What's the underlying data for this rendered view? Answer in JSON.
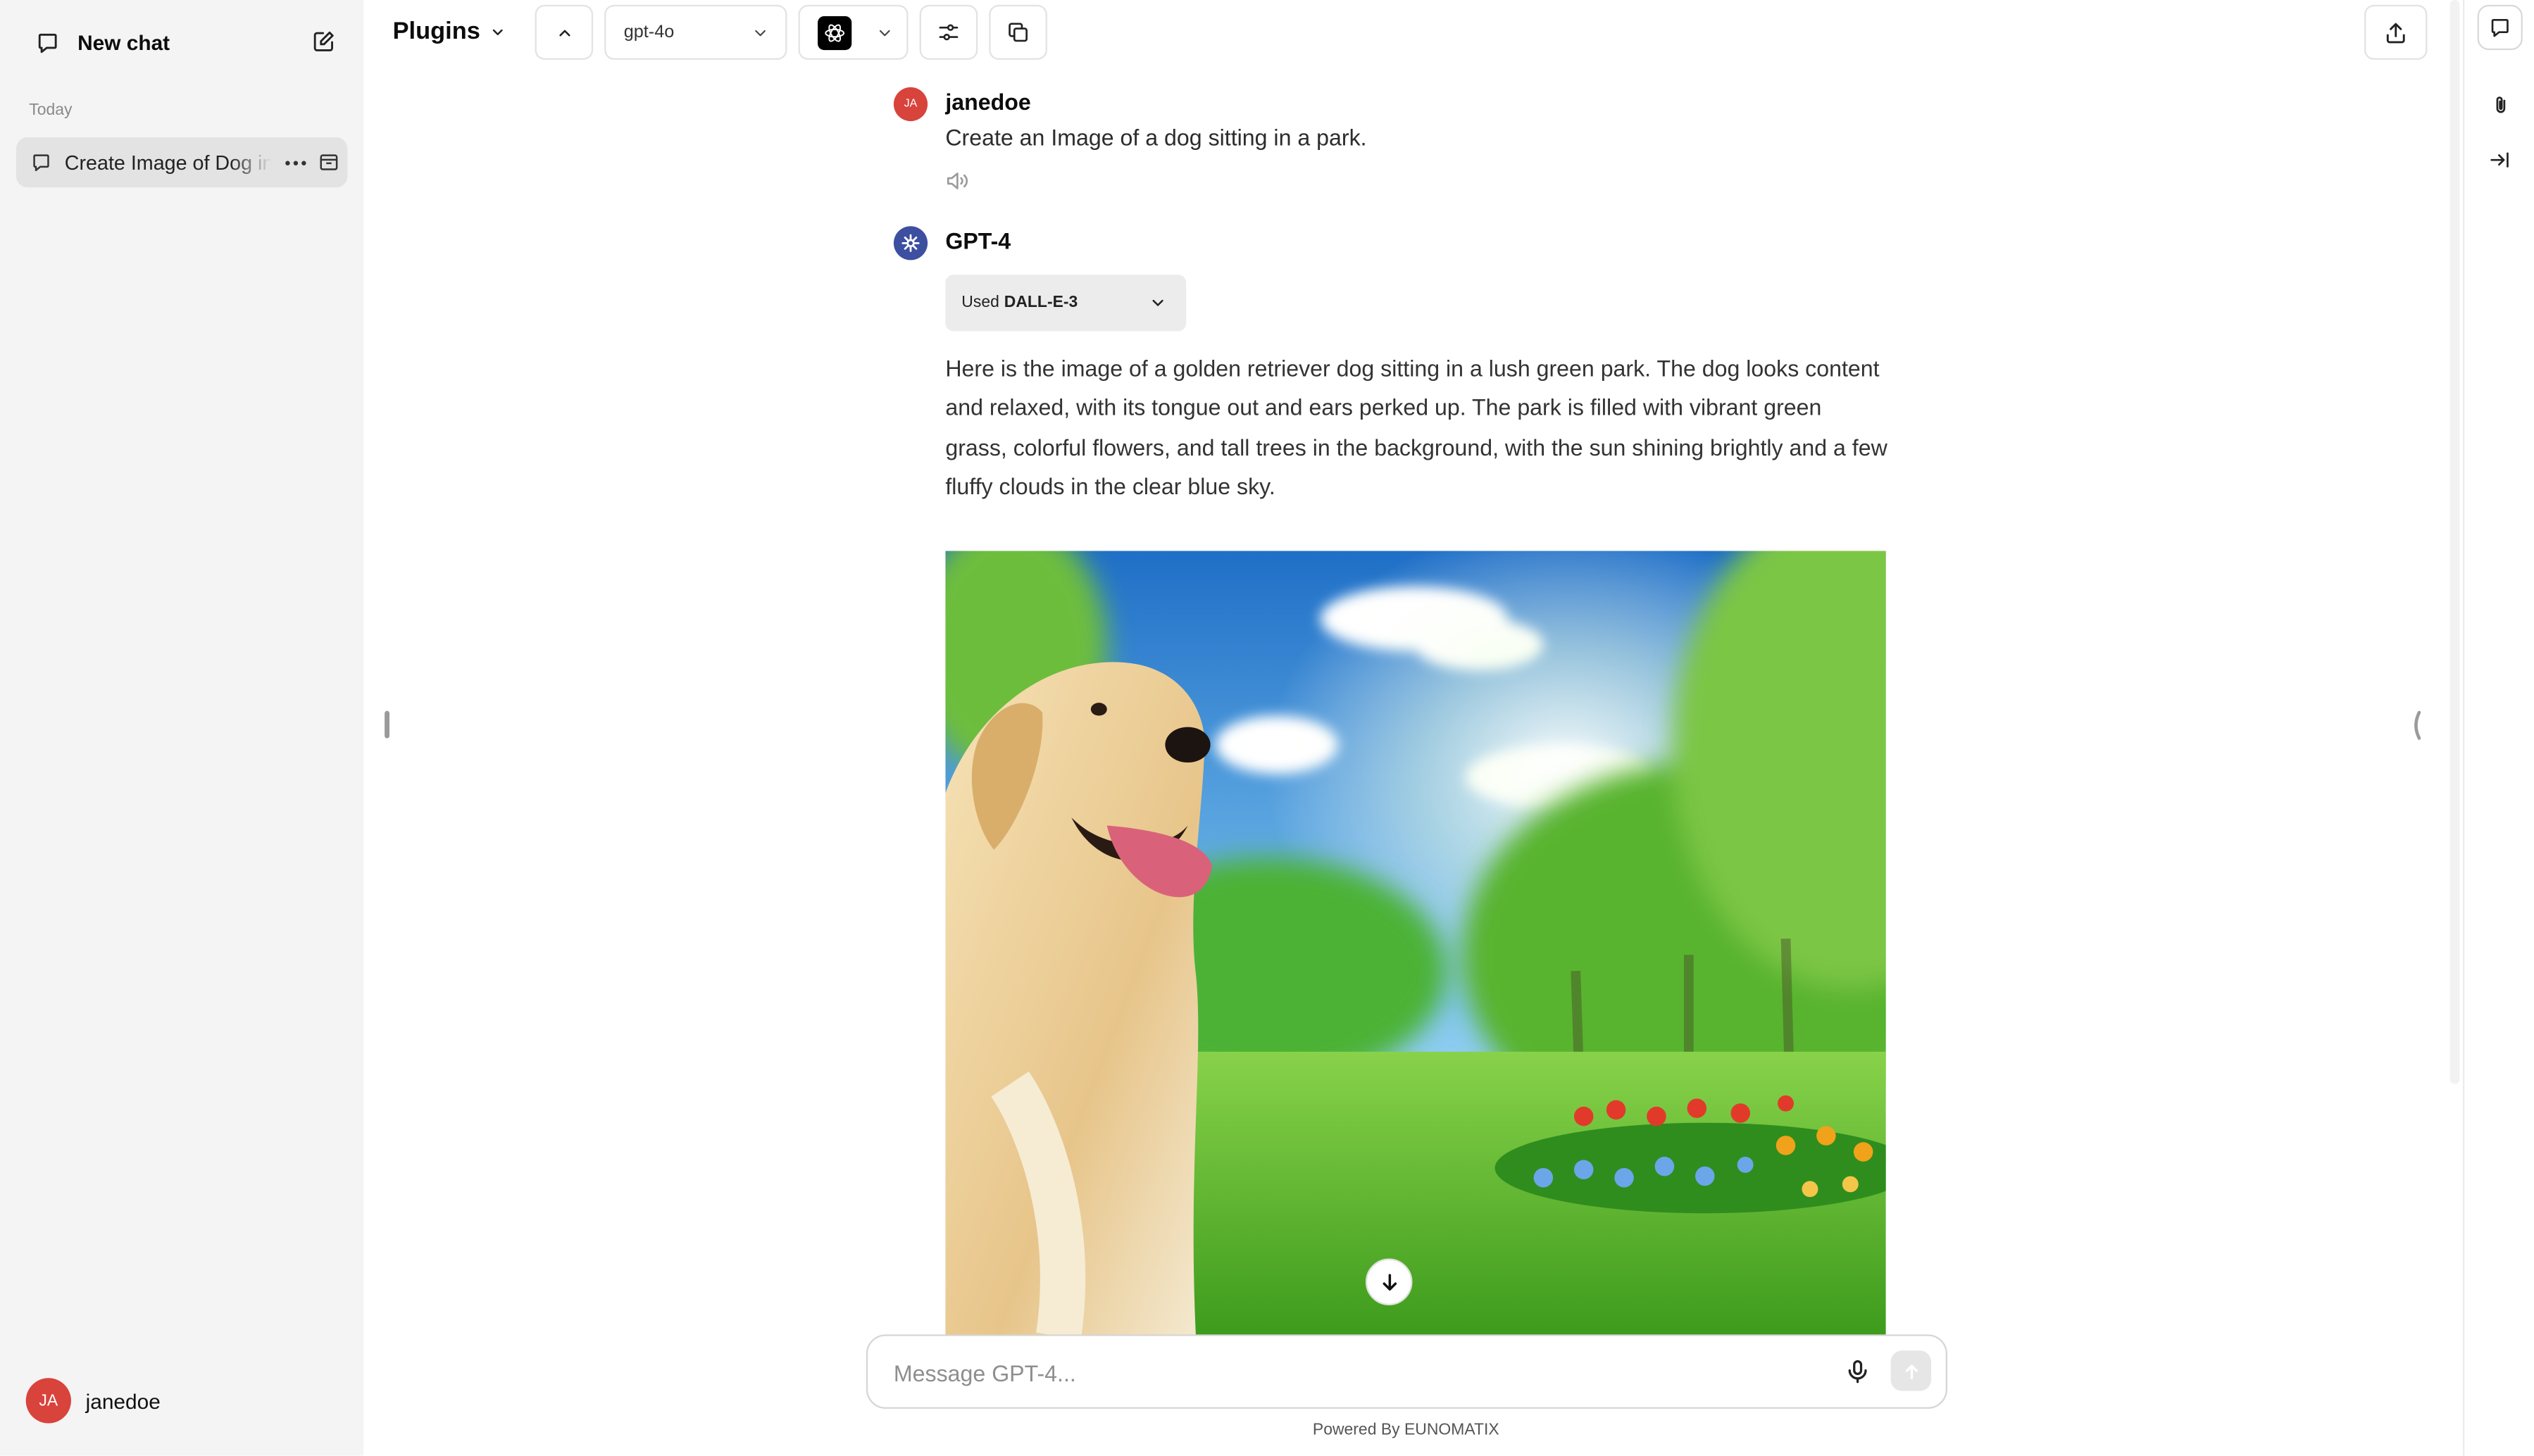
{
  "sidebar": {
    "new_chat": "New chat",
    "section_today": "Today",
    "conversations": [
      {
        "title": "Create Image of Dog in a Park"
      }
    ],
    "user": {
      "initials": "JA",
      "name": "janedoe"
    }
  },
  "header": {
    "title": "Plugins",
    "model": "gpt-4o"
  },
  "messages": {
    "user": {
      "initials": "JA",
      "name": "janedoe",
      "text": "Create an Image of a dog sitting in a park."
    },
    "assistant": {
      "name": "GPT-4",
      "tool_prefix": "Used",
      "tool_name": "DALL-E-3",
      "text": "Here is the image of a golden retriever dog sitting in a lush green park. The dog looks content and relaxed, with its tongue out and ears perked up. The park is filled with vibrant green grass, colorful flowers, and tall trees in the background, with the sun shining brightly and a few fluffy clouds in the clear blue sky."
    }
  },
  "composer": {
    "placeholder": "Message GPT-4..."
  },
  "footer": {
    "powered_by": "Powered By EUNOMATIX"
  },
  "colors": {
    "avatar": "#d8433b",
    "assistant_icon": "#3d4fa0",
    "sidebar_bg": "#f4f4f4",
    "selected_conv": "#e3e3e3"
  },
  "icons": {
    "new_chat": "chat-bubble-icon",
    "compose": "compose-icon",
    "speaker": "speaker-icon",
    "mic": "microphone-icon",
    "send": "send-arrow-icon"
  }
}
